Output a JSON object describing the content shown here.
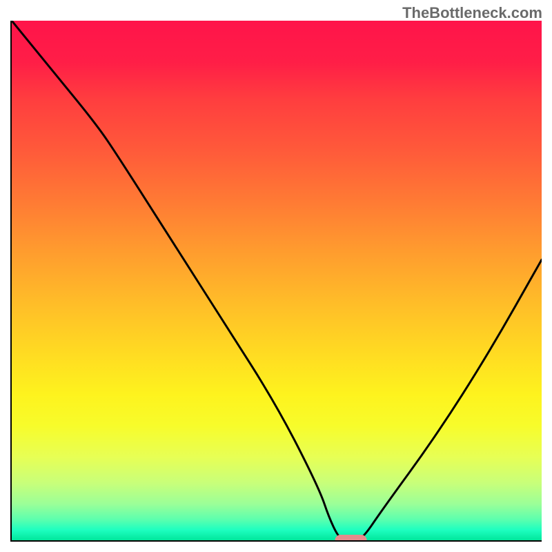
{
  "watermark": "TheBottleneck.com",
  "chart_data": {
    "type": "line",
    "title": "",
    "xlabel": "",
    "ylabel": "",
    "xlim": [
      0,
      100
    ],
    "ylim": [
      0,
      100
    ],
    "series": [
      {
        "name": "bottleneck-curve",
        "x": [
          0,
          8,
          16,
          20,
          30,
          40,
          50,
          58,
          60,
          62,
          64,
          66,
          70,
          80,
          90,
          100
        ],
        "y": [
          100,
          90,
          80,
          74,
          58,
          42,
          26,
          10,
          4,
          0,
          0,
          0,
          6,
          20,
          36,
          54
        ]
      }
    ],
    "marker": {
      "name": "optimal-range",
      "x_center": 64,
      "y": 0,
      "width_pct": 6,
      "color": "#e38c8c"
    },
    "background_gradient": {
      "top": "#ff144a",
      "bottom": "#00e69b",
      "description": "red-to-green heat gradient"
    }
  }
}
